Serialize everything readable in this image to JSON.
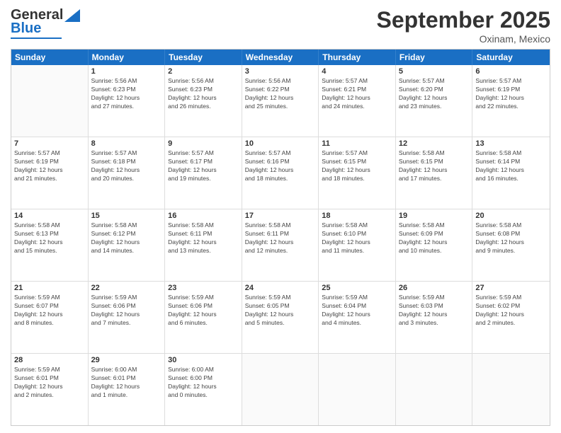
{
  "header": {
    "logo_line1": "General",
    "logo_line2": "Blue",
    "month": "September 2025",
    "location": "Oxinam, Mexico"
  },
  "days": [
    "Sunday",
    "Monday",
    "Tuesday",
    "Wednesday",
    "Thursday",
    "Friday",
    "Saturday"
  ],
  "weeks": [
    [
      {
        "day": "",
        "info": ""
      },
      {
        "day": "1",
        "info": "Sunrise: 5:56 AM\nSunset: 6:23 PM\nDaylight: 12 hours\nand 27 minutes."
      },
      {
        "day": "2",
        "info": "Sunrise: 5:56 AM\nSunset: 6:23 PM\nDaylight: 12 hours\nand 26 minutes."
      },
      {
        "day": "3",
        "info": "Sunrise: 5:56 AM\nSunset: 6:22 PM\nDaylight: 12 hours\nand 25 minutes."
      },
      {
        "day": "4",
        "info": "Sunrise: 5:57 AM\nSunset: 6:21 PM\nDaylight: 12 hours\nand 24 minutes."
      },
      {
        "day": "5",
        "info": "Sunrise: 5:57 AM\nSunset: 6:20 PM\nDaylight: 12 hours\nand 23 minutes."
      },
      {
        "day": "6",
        "info": "Sunrise: 5:57 AM\nSunset: 6:19 PM\nDaylight: 12 hours\nand 22 minutes."
      }
    ],
    [
      {
        "day": "7",
        "info": "Sunrise: 5:57 AM\nSunset: 6:19 PM\nDaylight: 12 hours\nand 21 minutes."
      },
      {
        "day": "8",
        "info": "Sunrise: 5:57 AM\nSunset: 6:18 PM\nDaylight: 12 hours\nand 20 minutes."
      },
      {
        "day": "9",
        "info": "Sunrise: 5:57 AM\nSunset: 6:17 PM\nDaylight: 12 hours\nand 19 minutes."
      },
      {
        "day": "10",
        "info": "Sunrise: 5:57 AM\nSunset: 6:16 PM\nDaylight: 12 hours\nand 18 minutes."
      },
      {
        "day": "11",
        "info": "Sunrise: 5:57 AM\nSunset: 6:15 PM\nDaylight: 12 hours\nand 18 minutes."
      },
      {
        "day": "12",
        "info": "Sunrise: 5:58 AM\nSunset: 6:15 PM\nDaylight: 12 hours\nand 17 minutes."
      },
      {
        "day": "13",
        "info": "Sunrise: 5:58 AM\nSunset: 6:14 PM\nDaylight: 12 hours\nand 16 minutes."
      }
    ],
    [
      {
        "day": "14",
        "info": "Sunrise: 5:58 AM\nSunset: 6:13 PM\nDaylight: 12 hours\nand 15 minutes."
      },
      {
        "day": "15",
        "info": "Sunrise: 5:58 AM\nSunset: 6:12 PM\nDaylight: 12 hours\nand 14 minutes."
      },
      {
        "day": "16",
        "info": "Sunrise: 5:58 AM\nSunset: 6:11 PM\nDaylight: 12 hours\nand 13 minutes."
      },
      {
        "day": "17",
        "info": "Sunrise: 5:58 AM\nSunset: 6:11 PM\nDaylight: 12 hours\nand 12 minutes."
      },
      {
        "day": "18",
        "info": "Sunrise: 5:58 AM\nSunset: 6:10 PM\nDaylight: 12 hours\nand 11 minutes."
      },
      {
        "day": "19",
        "info": "Sunrise: 5:58 AM\nSunset: 6:09 PM\nDaylight: 12 hours\nand 10 minutes."
      },
      {
        "day": "20",
        "info": "Sunrise: 5:58 AM\nSunset: 6:08 PM\nDaylight: 12 hours\nand 9 minutes."
      }
    ],
    [
      {
        "day": "21",
        "info": "Sunrise: 5:59 AM\nSunset: 6:07 PM\nDaylight: 12 hours\nand 8 minutes."
      },
      {
        "day": "22",
        "info": "Sunrise: 5:59 AM\nSunset: 6:06 PM\nDaylight: 12 hours\nand 7 minutes."
      },
      {
        "day": "23",
        "info": "Sunrise: 5:59 AM\nSunset: 6:06 PM\nDaylight: 12 hours\nand 6 minutes."
      },
      {
        "day": "24",
        "info": "Sunrise: 5:59 AM\nSunset: 6:05 PM\nDaylight: 12 hours\nand 5 minutes."
      },
      {
        "day": "25",
        "info": "Sunrise: 5:59 AM\nSunset: 6:04 PM\nDaylight: 12 hours\nand 4 minutes."
      },
      {
        "day": "26",
        "info": "Sunrise: 5:59 AM\nSunset: 6:03 PM\nDaylight: 12 hours\nand 3 minutes."
      },
      {
        "day": "27",
        "info": "Sunrise: 5:59 AM\nSunset: 6:02 PM\nDaylight: 12 hours\nand 2 minutes."
      }
    ],
    [
      {
        "day": "28",
        "info": "Sunrise: 5:59 AM\nSunset: 6:01 PM\nDaylight: 12 hours\nand 2 minutes."
      },
      {
        "day": "29",
        "info": "Sunrise: 6:00 AM\nSunset: 6:01 PM\nDaylight: 12 hours\nand 1 minute."
      },
      {
        "day": "30",
        "info": "Sunrise: 6:00 AM\nSunset: 6:00 PM\nDaylight: 12 hours\nand 0 minutes."
      },
      {
        "day": "",
        "info": ""
      },
      {
        "day": "",
        "info": ""
      },
      {
        "day": "",
        "info": ""
      },
      {
        "day": "",
        "info": ""
      }
    ]
  ]
}
